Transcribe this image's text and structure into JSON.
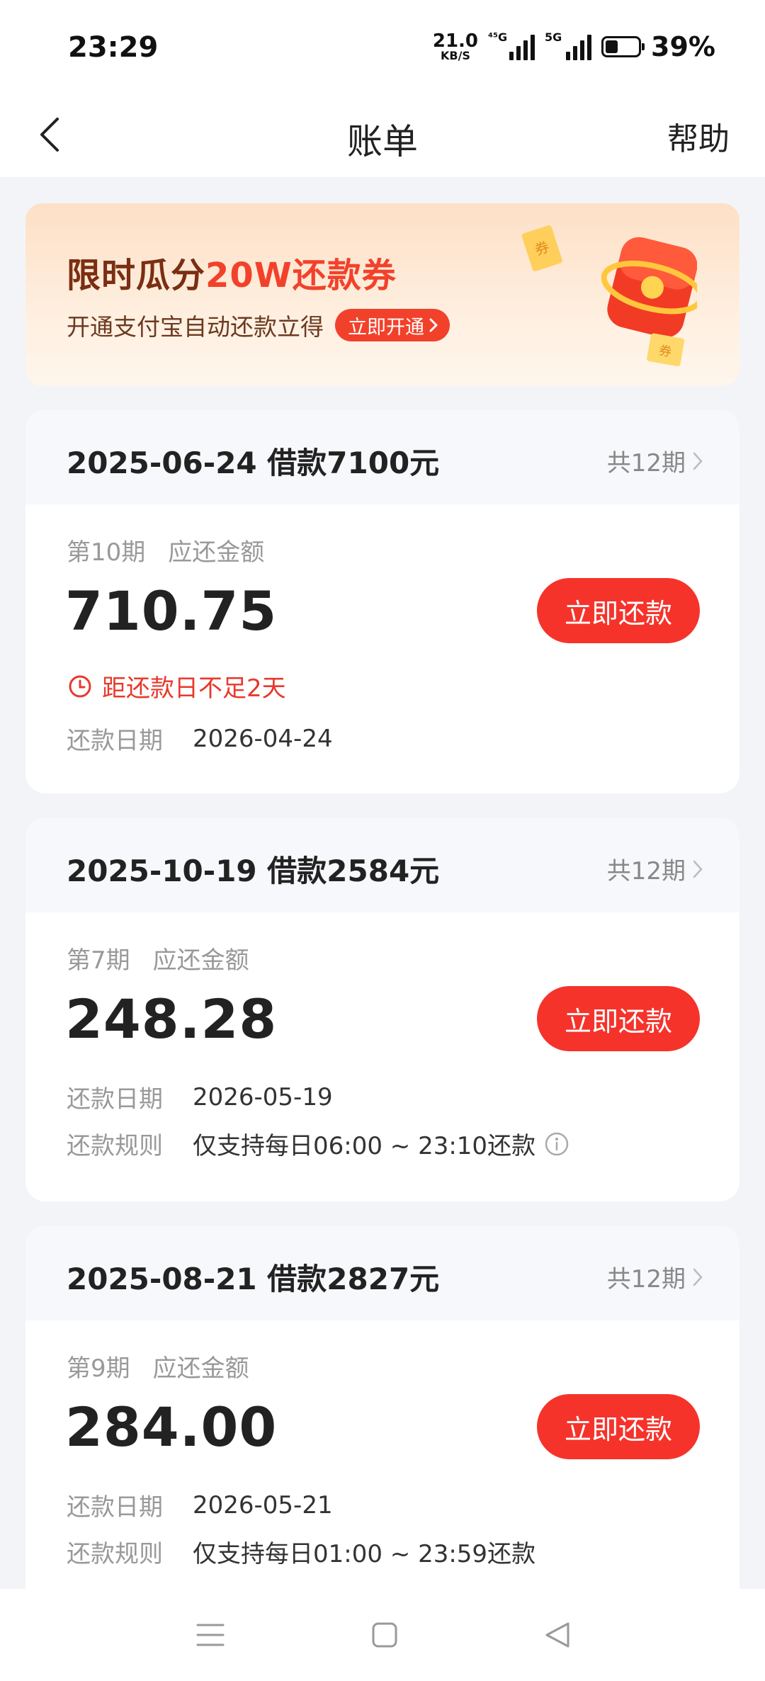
{
  "status": {
    "time": "23:29",
    "net_speed_value": "21.0",
    "net_speed_unit": "KB/S",
    "sim1_tag": "⁴⁵G",
    "sim2_tag": "5G",
    "battery": "39%",
    "battery_level": 0.39
  },
  "nav": {
    "title": "账单",
    "help": "帮助"
  },
  "promo": {
    "title_a": "限时瓜分",
    "title_b": "20W还款券",
    "subtitle": "开通支付宝自动还款立得",
    "button": "立即开通"
  },
  "bills": [
    {
      "loan": "2025-06-24 借款7100元",
      "periods": "共12期",
      "term": "第10期",
      "due_label": "应还金额",
      "amount": "710.75",
      "pay_button": "立即还款",
      "warning": "距还款日不足2天",
      "date_label": "还款日期",
      "date": "2026-04-24"
    },
    {
      "loan": "2025-10-19 借款2584元",
      "periods": "共12期",
      "term": "第7期",
      "due_label": "应还金额",
      "amount": "248.28",
      "pay_button": "立即还款",
      "date_label": "还款日期",
      "date": "2026-05-19",
      "rule_label": "还款规则",
      "rule": "仅支持每日06:00 ~ 23:10还款"
    },
    {
      "loan": "2025-08-21 借款2827元",
      "periods": "共12期",
      "term": "第9期",
      "due_label": "应还金额",
      "amount": "284.00",
      "pay_button": "立即还款",
      "date_label": "还款日期",
      "date": "2026-05-21",
      "rule_label": "还款规则",
      "rule": "仅支持每日01:00 ~ 23:59还款"
    }
  ],
  "colors": {
    "accent": "#f5332b",
    "warning": "#e8392c",
    "promo_title": "#7a2e12"
  }
}
